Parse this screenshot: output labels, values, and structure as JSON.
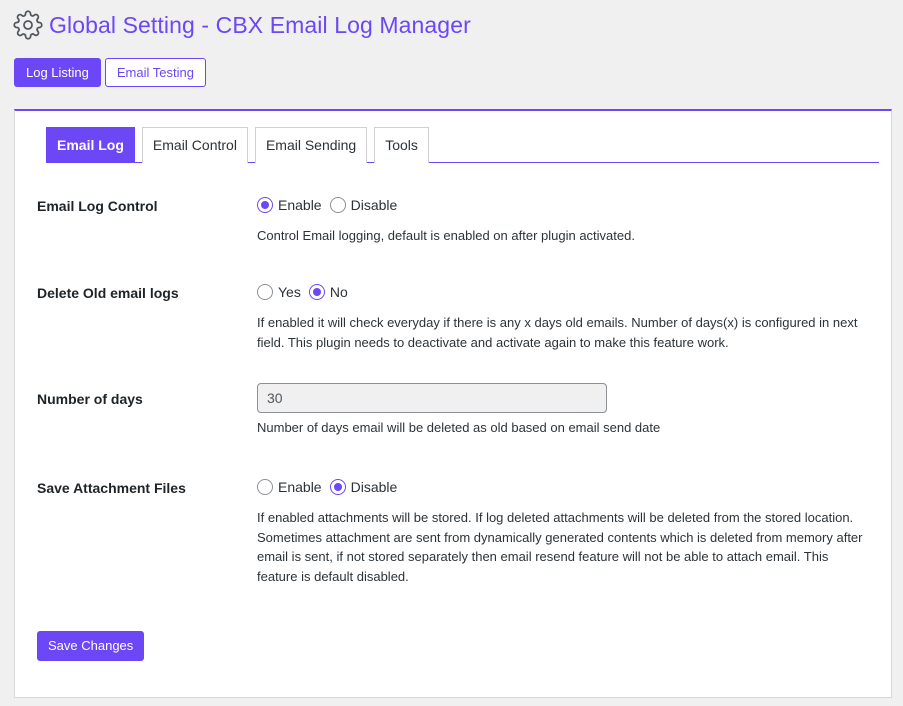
{
  "page": {
    "title": "Global Setting - CBX Email Log Manager",
    "icon": "gear-icon",
    "accent": "#6b47f5"
  },
  "topnav": {
    "items": [
      {
        "label": "Log Listing",
        "active": true
      },
      {
        "label": "Email Testing",
        "active": false
      }
    ]
  },
  "tabs": [
    {
      "label": "Email Log",
      "active": true
    },
    {
      "label": "Email Control",
      "active": false
    },
    {
      "label": "Email Sending",
      "active": false
    },
    {
      "label": "Tools",
      "active": false
    }
  ],
  "settings": {
    "email_log_control": {
      "label": "Email Log Control",
      "options": [
        {
          "label": "Enable",
          "selected": true
        },
        {
          "label": "Disable",
          "selected": false
        }
      ],
      "description": "Control Email logging, default is enabled on after plugin activated."
    },
    "delete_old_logs": {
      "label": "Delete Old email logs",
      "options": [
        {
          "label": "Yes",
          "selected": false
        },
        {
          "label": "No",
          "selected": true
        }
      ],
      "description": "If enabled it will check everyday if there is any x days old emails. Number of days(x) is configured in next field. This plugin needs to deactivate and activate again to make this feature work."
    },
    "number_of_days": {
      "label": "Number of days",
      "value": "30",
      "description": "Number of days email will be deleted as old based on email send date"
    },
    "save_attachments": {
      "label": "Save Attachment Files",
      "options": [
        {
          "label": "Enable",
          "selected": false
        },
        {
          "label": "Disable",
          "selected": true
        }
      ],
      "description": "If enabled attachments will be stored. If log deleted attachments will be deleted from the stored location. Sometimes attachment are sent from dynamically generated contents which is deleted from memory after email is sent, if not stored separately then email resend feature will not be able to attach email. This feature is default disabled."
    }
  },
  "save_button": {
    "label": "Save Changes"
  }
}
